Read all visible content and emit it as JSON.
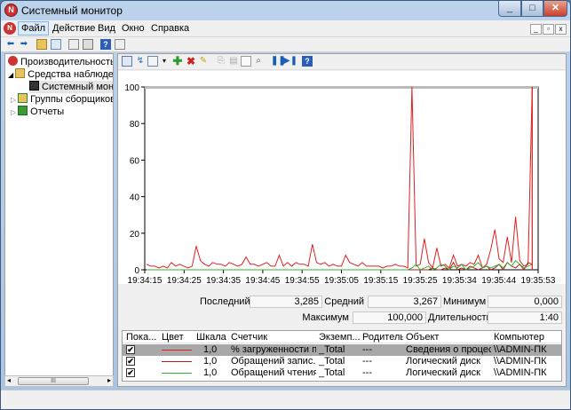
{
  "window": {
    "title": "Системный монитор"
  },
  "menu": {
    "items": [
      "Файл",
      "Действие",
      "Вид",
      "Окно",
      "Справка"
    ]
  },
  "tree": {
    "items": [
      {
        "label": "Производительность",
        "level": 0
      },
      {
        "label": "Средства наблюдения",
        "level": 1
      },
      {
        "label": "Системный монитор",
        "level": 2
      },
      {
        "label": "Группы сборщиков данных",
        "level": 1
      },
      {
        "label": "Отчеты",
        "level": 1
      }
    ]
  },
  "chart_data": {
    "type": "line",
    "ylim": [
      0,
      100
    ],
    "yticks": [
      "100",
      "80",
      "60",
      "40",
      "20",
      "0"
    ],
    "xticks": [
      "19:34:15",
      "19:34:25",
      "19:34:35",
      "19:34:45",
      "19:34:55",
      "19:35:05",
      "19:35:15",
      "19:35:25",
      "19:35:34",
      "19:35:44",
      "19:35:53"
    ],
    "series": [
      {
        "name": "% загруженности процессора",
        "color": "#e02020",
        "values": [
          3,
          2,
          2,
          1,
          2,
          1,
          4,
          2,
          3,
          2,
          1,
          2,
          13,
          5,
          3,
          2,
          4,
          3,
          3,
          2,
          4,
          3,
          2,
          3,
          7,
          3,
          3,
          2,
          3,
          4,
          2,
          2,
          8,
          2,
          4,
          2,
          4,
          3,
          3,
          2,
          14,
          4,
          3,
          4,
          2,
          3,
          2,
          2,
          8,
          4,
          3,
          2,
          4,
          2,
          2,
          2,
          2,
          1,
          2,
          2,
          3,
          2,
          2,
          1,
          100,
          2,
          3,
          17,
          4,
          1,
          12,
          2,
          3,
          1,
          8,
          2,
          3,
          2,
          4,
          3,
          8,
          1,
          3,
          11,
          22,
          6,
          4,
          18,
          4,
          29,
          5,
          2,
          3,
          100
        ]
      },
      {
        "name": "Обращений записи на диск/с",
        "color": "#c01818",
        "values": [
          0,
          0,
          0,
          0,
          0,
          0,
          0,
          0,
          0,
          0,
          0,
          0,
          0,
          0,
          0,
          0,
          0,
          0,
          0,
          0,
          0,
          0,
          0,
          0,
          0,
          0,
          0,
          0,
          0,
          0,
          0,
          0,
          0,
          0,
          0,
          0,
          0,
          0,
          0,
          0,
          0,
          0,
          0,
          0,
          0,
          0,
          0,
          0,
          0,
          0,
          0,
          0,
          0,
          0,
          0,
          0,
          0,
          0,
          0,
          0,
          0,
          0,
          0,
          0,
          0,
          0,
          0,
          0,
          0,
          1,
          0,
          0,
          1,
          0,
          4,
          0,
          1,
          0,
          2,
          1,
          0,
          1,
          2,
          0,
          1,
          3,
          0,
          4,
          2,
          1,
          3,
          0,
          4,
          3
        ]
      },
      {
        "name": "Обращений чтения с диска/с",
        "color": "#30b030",
        "values": [
          0,
          0,
          0,
          0,
          0,
          0,
          0,
          0,
          0,
          0,
          0,
          0,
          0,
          0,
          0,
          0,
          0,
          0,
          0,
          0,
          0,
          0,
          0,
          0,
          0,
          0,
          0,
          0,
          0,
          0,
          0,
          0,
          0,
          0,
          0,
          0,
          0,
          0,
          0,
          0,
          0,
          0,
          0,
          0,
          0,
          0,
          0,
          0,
          0,
          0,
          0,
          0,
          0,
          0,
          0,
          0,
          0,
          0,
          0,
          0,
          0,
          0,
          0,
          0,
          1,
          3,
          0,
          1,
          2,
          0,
          1,
          3,
          2,
          0,
          2,
          1,
          3,
          0,
          1,
          2,
          4,
          1,
          2,
          1,
          2,
          3,
          1,
          4,
          2,
          5,
          3,
          1,
          2,
          3
        ]
      }
    ]
  },
  "stats": {
    "last_label": "Последний",
    "last_value": "3,285",
    "avg_label": "Средний",
    "avg_value": "3,267",
    "min_label": "Минимум",
    "min_value": "0,000",
    "max_label": "Максимум",
    "max_value": "100,000",
    "dur_label": "Длительность",
    "dur_value": "1:40"
  },
  "counters": {
    "headers": [
      "Пока...",
      "Цвет",
      "Шкала",
      "Счетчик",
      "Экземп...",
      "Родитель",
      "Объект",
      "Компьютер"
    ],
    "rows": [
      {
        "show": "✔",
        "color": "#e02020",
        "scale": "1,0",
        "counter": "% загруженности п...",
        "instance": "_Total",
        "parent": "---",
        "object": "Сведения о процес...",
        "computer": "\\\\ADMIN-ПК",
        "selected": true
      },
      {
        "show": "✔",
        "color": "#c01818",
        "scale": "1,0",
        "counter": "Обращений запис...",
        "instance": "_Total",
        "parent": "---",
        "object": "Логический диск",
        "computer": "\\\\ADMIN-ПК",
        "selected": false
      },
      {
        "show": "✔",
        "color": "#30b030",
        "scale": "1,0",
        "counter": "Обращений чтения...",
        "instance": "_Total",
        "parent": "---",
        "object": "Логический диск",
        "computer": "\\\\ADMIN-ПК",
        "selected": false
      }
    ]
  }
}
